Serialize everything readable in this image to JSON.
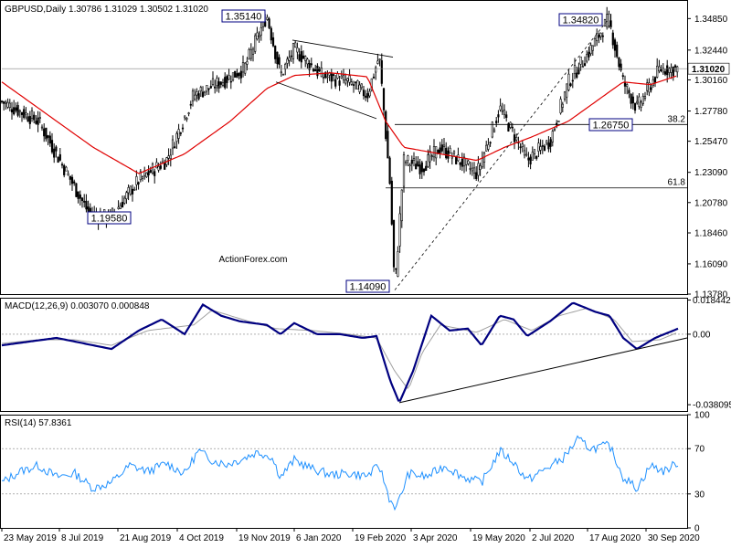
{
  "chart_data": [
    {
      "type": "candlestick",
      "title": "GBPUSD,Daily  1.30786 1.31029 1.30502 1.31020",
      "symbol": "GBPUSD",
      "timeframe": "Daily",
      "ohlc_last": {
        "open": 1.30786,
        "high": 1.31029,
        "low": 1.30502,
        "close": 1.3102
      },
      "current_price_label": "1.31020",
      "ylim": [
        1.1378,
        1.3613
      ],
      "yticks": [
        "1.34850",
        "1.32440",
        "1.30160",
        "1.27780",
        "1.25470",
        "1.23090",
        "1.20780",
        "1.18460",
        "1.16090",
        "1.13780"
      ],
      "xticks": [
        "23 May 2019",
        "8 Jul 2019",
        "21 Aug 2019",
        "4 Oct 2019",
        "19 Nov 2019",
        "6 Jan 2020",
        "19 Feb 2020",
        "3 Apr 2020",
        "19 May 2020",
        "2 Jul 2020",
        "17 Aug 2020",
        "30 Sep 2020"
      ],
      "annotations": [
        {
          "text": "1.35140",
          "date_index": 290,
          "value": 1.3514
        },
        {
          "text": "1.19580",
          "date_index": 118,
          "value": 1.1958
        },
        {
          "text": "1.14090",
          "date_index": 430,
          "value": 1.1409
        },
        {
          "text": "1.34820",
          "date_index": 664,
          "value": 1.3482
        },
        {
          "text": "1.26750",
          "date_index": 695,
          "value": 1.2675
        }
      ],
      "fibonacci_levels": [
        {
          "label": "38.2",
          "value": 1.2675
        },
        {
          "label": "61.8",
          "value": 1.219
        }
      ],
      "series_keypoints": [
        [
          0,
          1.285
        ],
        [
          40,
          1.27
        ],
        [
          95,
          1.2
        ],
        [
          118,
          1.196
        ],
        [
          150,
          1.225
        ],
        [
          180,
          1.24
        ],
        [
          210,
          1.29
        ],
        [
          240,
          1.3
        ],
        [
          265,
          1.31
        ],
        [
          290,
          1.351
        ],
        [
          305,
          1.305
        ],
        [
          320,
          1.325
        ],
        [
          350,
          1.305
        ],
        [
          380,
          1.3
        ],
        [
          400,
          1.29
        ],
        [
          413,
          1.32
        ],
        [
          425,
          1.22
        ],
        [
          430,
          1.141
        ],
        [
          440,
          1.24
        ],
        [
          460,
          1.235
        ],
        [
          480,
          1.25
        ],
        [
          500,
          1.24
        ],
        [
          520,
          1.23
        ],
        [
          545,
          1.28
        ],
        [
          560,
          1.26
        ],
        [
          575,
          1.24
        ],
        [
          600,
          1.255
        ],
        [
          620,
          1.3
        ],
        [
          640,
          1.32
        ],
        [
          664,
          1.348
        ],
        [
          680,
          1.3
        ],
        [
          695,
          1.28
        ],
        [
          720,
          1.31
        ],
        [
          740,
          1.31
        ]
      ],
      "moving_average_keypoints": [
        [
          0,
          1.3
        ],
        [
          40,
          1.28
        ],
        [
          100,
          1.25
        ],
        [
          150,
          1.23
        ],
        [
          200,
          1.245
        ],
        [
          250,
          1.27
        ],
        [
          290,
          1.295
        ],
        [
          320,
          1.305
        ],
        [
          360,
          1.307
        ],
        [
          400,
          1.304
        ],
        [
          420,
          1.27
        ],
        [
          440,
          1.25
        ],
        [
          480,
          1.245
        ],
        [
          520,
          1.24
        ],
        [
          550,
          1.25
        ],
        [
          580,
          1.258
        ],
        [
          620,
          1.27
        ],
        [
          650,
          1.285
        ],
        [
          680,
          1.3
        ],
        [
          710,
          1.298
        ],
        [
          740,
          1.305
        ]
      ],
      "colors": {
        "candles": "#000000",
        "moving_average": "#e00000",
        "annotation_border": "#000080",
        "grid_line": "#808080"
      }
    },
    {
      "type": "line",
      "title": "MACD(12,26,9) 0.003070 0.000848",
      "indicator": "MACD",
      "params": "12,26,9",
      "macd_value": 0.00307,
      "signal_value": 0.000848,
      "ylim": [
        -0.0415,
        0.0197
      ],
      "yticks": [
        "0.018442",
        "0.00",
        "-0.038095"
      ],
      "series": [
        {
          "name": "MACD",
          "keypoints": [
            [
              0,
              -0.006
            ],
            [
              30,
              -0.004
            ],
            [
              60,
              -0.002
            ],
            [
              90,
              -0.005
            ],
            [
              120,
              -0.008
            ],
            [
              150,
              0.002
            ],
            [
              175,
              0.008
            ],
            [
              200,
              0.0
            ],
            [
              220,
              0.016
            ],
            [
              240,
              0.01
            ],
            [
              260,
              0.007
            ],
            [
              290,
              0.005
            ],
            [
              305,
              0.0
            ],
            [
              320,
              0.006
            ],
            [
              345,
              0.0
            ],
            [
              370,
              0.0
            ],
            [
              395,
              -0.002
            ],
            [
              410,
              -0.001
            ],
            [
              425,
              -0.025
            ],
            [
              435,
              -0.037
            ],
            [
              450,
              -0.02
            ],
            [
              470,
              0.01
            ],
            [
              490,
              0.002
            ],
            [
              510,
              0.003
            ],
            [
              525,
              -0.006
            ],
            [
              545,
              0.01
            ],
            [
              560,
              0.008
            ],
            [
              575,
              -0.001
            ],
            [
              600,
              0.007
            ],
            [
              625,
              0.017
            ],
            [
              650,
              0.012
            ],
            [
              665,
              0.01
            ],
            [
              680,
              -0.002
            ],
            [
              695,
              -0.008
            ],
            [
              715,
              -0.002
            ],
            [
              740,
              0.003
            ]
          ]
        },
        {
          "name": "Signal",
          "keypoints": [
            [
              0,
              -0.005
            ],
            [
              40,
              -0.003
            ],
            [
              80,
              -0.003
            ],
            [
              120,
              -0.006
            ],
            [
              160,
              0.002
            ],
            [
              210,
              0.005
            ],
            [
              230,
              0.013
            ],
            [
              270,
              0.007
            ],
            [
              300,
              0.003
            ],
            [
              340,
              0.002
            ],
            [
              380,
              0.0
            ],
            [
              410,
              -0.002
            ],
            [
              430,
              -0.02
            ],
            [
              445,
              -0.03
            ],
            [
              460,
              -0.01
            ],
            [
              480,
              0.005
            ],
            [
              520,
              0.001
            ],
            [
              550,
              0.008
            ],
            [
              580,
              0.002
            ],
            [
              610,
              0.01
            ],
            [
              640,
              0.014
            ],
            [
              670,
              0.008
            ],
            [
              690,
              -0.004
            ],
            [
              720,
              -0.003
            ],
            [
              740,
              0.001
            ]
          ]
        }
      ],
      "trendline": {
        "from": [
          435,
          -0.037
        ],
        "to": [
          750,
          -0.002
        ]
      },
      "colors": {
        "macd": "#000080",
        "signal": "#a0a0a0",
        "trendline": "#000000"
      }
    },
    {
      "type": "line",
      "title": "RSI(14) 57.8361",
      "indicator": "RSI",
      "period": 14,
      "value": 57.8361,
      "ylim": [
        0,
        100
      ],
      "yticks": [
        "100",
        "70",
        "30",
        "0"
      ],
      "levels": [
        70,
        30
      ],
      "keypoints": [
        [
          0,
          40
        ],
        [
          20,
          50
        ],
        [
          40,
          55
        ],
        [
          60,
          45
        ],
        [
          80,
          48
        ],
        [
          100,
          35
        ],
        [
          120,
          40
        ],
        [
          140,
          55
        ],
        [
          160,
          50
        ],
        [
          180,
          57
        ],
        [
          200,
          48
        ],
        [
          215,
          68
        ],
        [
          230,
          60
        ],
        [
          245,
          56
        ],
        [
          260,
          60
        ],
        [
          280,
          67
        ],
        [
          295,
          63
        ],
        [
          305,
          45
        ],
        [
          320,
          60
        ],
        [
          340,
          52
        ],
        [
          360,
          47
        ],
        [
          380,
          48
        ],
        [
          400,
          46
        ],
        [
          413,
          55
        ],
        [
          425,
          24
        ],
        [
          432,
          18
        ],
        [
          445,
          48
        ],
        [
          465,
          45
        ],
        [
          485,
          55
        ],
        [
          505,
          45
        ],
        [
          525,
          40
        ],
        [
          545,
          68
        ],
        [
          560,
          58
        ],
        [
          575,
          42
        ],
        [
          595,
          52
        ],
        [
          615,
          62
        ],
        [
          630,
          78
        ],
        [
          645,
          70
        ],
        [
          665,
          73
        ],
        [
          680,
          45
        ],
        [
          695,
          35
        ],
        [
          710,
          55
        ],
        [
          725,
          50
        ],
        [
          740,
          57.8
        ]
      ],
      "colors": {
        "rsi": "#1e90ff",
        "levels": "#808080"
      }
    }
  ],
  "watermark": "ActionForex.com"
}
